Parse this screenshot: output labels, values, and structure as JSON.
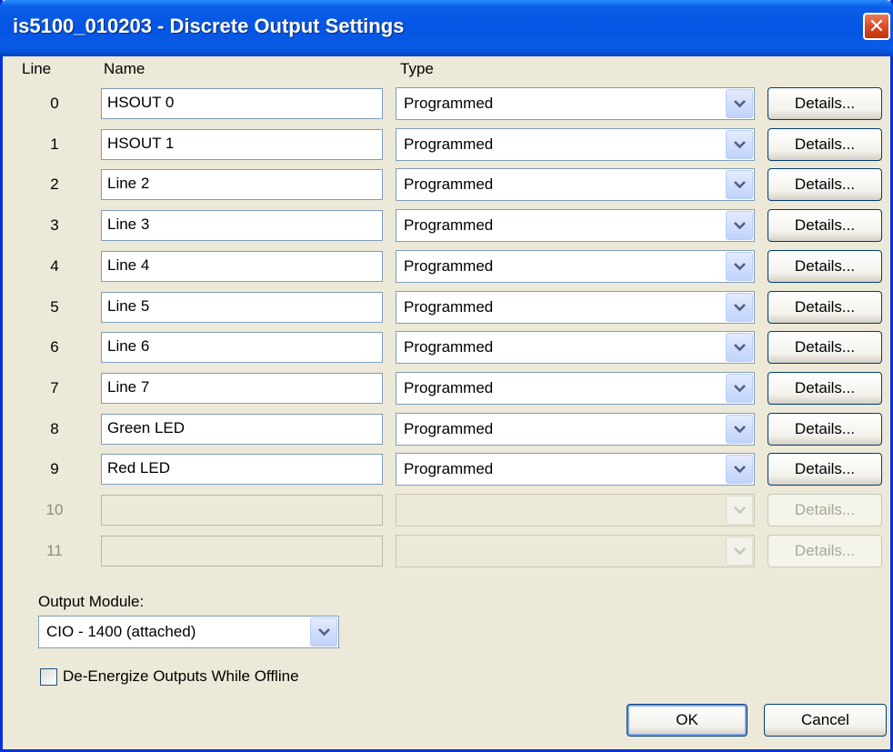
{
  "window": {
    "title": "is5100_010203 - Discrete Output Settings",
    "close_glyph": "✕",
    "title_color": "#0554e3"
  },
  "headers": {
    "line": "Line",
    "name": "Name",
    "type": "Type"
  },
  "rows": [
    {
      "line": "0",
      "name": "HSOUT 0",
      "type": "Programmed",
      "details": "Details...",
      "enabled": true
    },
    {
      "line": "1",
      "name": "HSOUT 1",
      "type": "Programmed",
      "details": "Details...",
      "enabled": true
    },
    {
      "line": "2",
      "name": "Line 2",
      "type": "Programmed",
      "details": "Details...",
      "enabled": true
    },
    {
      "line": "3",
      "name": "Line 3",
      "type": "Programmed",
      "details": "Details...",
      "enabled": true
    },
    {
      "line": "4",
      "name": "Line 4",
      "type": "Programmed",
      "details": "Details...",
      "enabled": true
    },
    {
      "line": "5",
      "name": "Line 5",
      "type": "Programmed",
      "details": "Details...",
      "enabled": true
    },
    {
      "line": "6",
      "name": "Line 6",
      "type": "Programmed",
      "details": "Details...",
      "enabled": true
    },
    {
      "line": "7",
      "name": "Line 7",
      "type": "Programmed",
      "details": "Details...",
      "enabled": true
    },
    {
      "line": "8",
      "name": "Green LED",
      "type": "Programmed",
      "details": "Details...",
      "enabled": true
    },
    {
      "line": "9",
      "name": "Red LED",
      "type": "Programmed",
      "details": "Details...",
      "enabled": true
    },
    {
      "line": "10",
      "name": "",
      "type": "",
      "details": "Details...",
      "enabled": false
    },
    {
      "line": "11",
      "name": "",
      "type": "",
      "details": "Details...",
      "enabled": false
    }
  ],
  "output_module": {
    "label": "Output Module:",
    "value": "CIO - 1400 (attached)"
  },
  "de_energize": {
    "label": "De-Energize Outputs While Offline",
    "checked": false
  },
  "buttons": {
    "ok": "OK",
    "cancel": "Cancel"
  },
  "icons": {
    "dropdown": "chevron-down-icon",
    "close": "close-icon"
  }
}
